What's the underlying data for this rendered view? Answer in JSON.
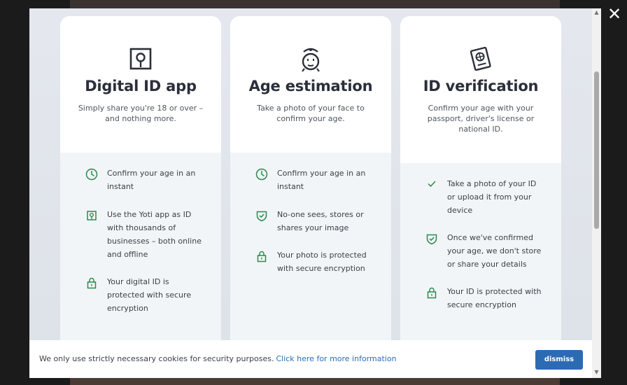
{
  "close_icon_glyph": "✕",
  "accent_color": "#2a8a4e",
  "cards": [
    {
      "title": "Digital ID app",
      "description": "Simply share you're 18 or over – and nothing more.",
      "icon": "digital-id-icon",
      "features": [
        {
          "icon": "clock-icon",
          "text": "Confirm your age in an instant"
        },
        {
          "icon": "yoti-app-icon",
          "text": "Use the Yoti app as ID with thousands of businesses – both online and offline"
        },
        {
          "icon": "lock-icon",
          "text": "Your digital ID is protected with secure encryption"
        }
      ]
    },
    {
      "title": "Age estimation",
      "description": "Take a photo of your face to confirm your age.",
      "icon": "face-scan-icon",
      "features": [
        {
          "icon": "clock-icon",
          "text": "Confirm your age in an instant"
        },
        {
          "icon": "shield-check-icon",
          "text": "No-one sees, stores or shares your image"
        },
        {
          "icon": "lock-icon",
          "text": "Your photo is protected with secure encryption"
        }
      ]
    },
    {
      "title": "ID verification",
      "description": "Confirm your age with your passport, driver's license or national ID.",
      "icon": "passport-icon",
      "features": [
        {
          "icon": "check-icon",
          "text": "Take a photo of your ID or upload it from your device"
        },
        {
          "icon": "shield-check-icon",
          "text": "Once we've confirmed your age, we don't store or share your details"
        },
        {
          "icon": "lock-icon",
          "text": "Your ID is protected with secure encryption"
        }
      ]
    }
  ],
  "cookie_bar": {
    "text": "We only use strictly necessary cookies for security purposes.",
    "link_text": "Click here for more information",
    "dismiss_label": "dismiss"
  }
}
